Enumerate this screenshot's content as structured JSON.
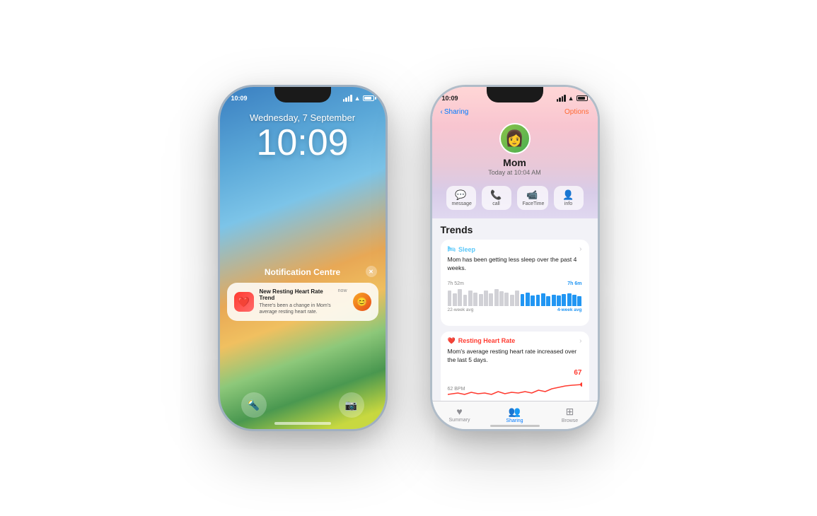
{
  "left_phone": {
    "status": {
      "time": "10:09",
      "signal": "●●●●",
      "wifi": "wifi",
      "battery": "battery"
    },
    "lockscreen": {
      "date": "Wednesday, 7 September",
      "time": "10:09",
      "notification_center": "Notification Centre",
      "notification": {
        "title": "New Resting Heart Rate Trend",
        "body": "There's been a change in Mom's average resting heart rate.",
        "time": "now"
      }
    },
    "bottom_buttons": {
      "left_icon": "🔦",
      "right_icon": "📷"
    }
  },
  "right_phone": {
    "status": {
      "time": "10:09"
    },
    "nav": {
      "back": "Sharing",
      "options": "Options"
    },
    "profile": {
      "name": "Mom",
      "time_label": "Today at 10:04 AM",
      "emoji": "👩"
    },
    "actions": [
      {
        "icon": "💬",
        "label": "message"
      },
      {
        "icon": "📞",
        "label": "call"
      },
      {
        "icon": "📹",
        "label": "FaceTime"
      },
      {
        "icon": "👤",
        "label": "info"
      }
    ],
    "trends": {
      "title": "Trends",
      "sleep": {
        "title": "Sleep",
        "icon": "🛏",
        "color": "#5ac8fa",
        "description": "Mom has been getting less sleep over the past 4 weeks.",
        "left_value": "7h 52m",
        "right_value": "7h 6m",
        "footer_left": "22-week avg",
        "footer_right": "4-week avg",
        "bars_gray": [
          8,
          7,
          9,
          6,
          8,
          7,
          6,
          8,
          7,
          9,
          8,
          7,
          6,
          8,
          7,
          9,
          8,
          7
        ],
        "bars_blue": [
          6,
          7,
          5,
          6,
          7,
          5,
          6,
          5,
          6,
          7,
          6,
          5
        ]
      },
      "heart_rate": {
        "title": "Resting Heart Rate",
        "icon": "❤️",
        "color": "#ff3b30",
        "description": "Mom's average resting heart rate increased over the last 5 days.",
        "left_value": "62 BPM",
        "right_value": "67"
      }
    },
    "tabs": [
      {
        "icon": "♥",
        "label": "Summary",
        "active": false
      },
      {
        "icon": "👥",
        "label": "Sharing",
        "active": true
      },
      {
        "icon": "⊞",
        "label": "Browse",
        "active": false
      }
    ]
  }
}
